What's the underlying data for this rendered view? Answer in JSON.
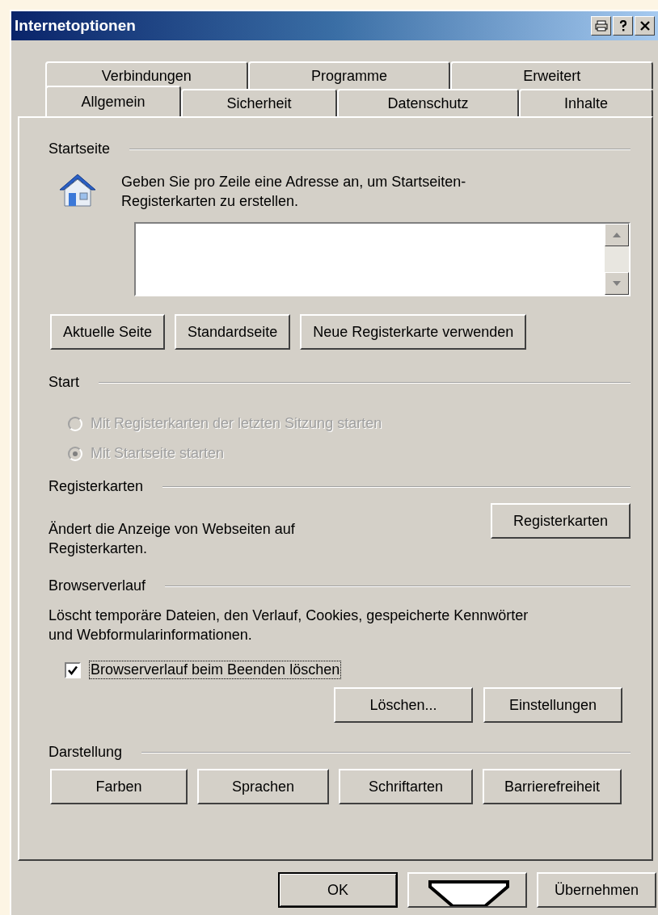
{
  "window": {
    "title": "Internetoptionen"
  },
  "tab_rows": [
    [
      {
        "label": "Verbindungen",
        "selected": false
      },
      {
        "label": "Programme",
        "selected": false
      },
      {
        "label": "Erweitert",
        "selected": false
      }
    ],
    [
      {
        "label": "Allgemein",
        "selected": true
      },
      {
        "label": "Sicherheit",
        "selected": false
      },
      {
        "label": "Datenschutz",
        "selected": false
      },
      {
        "label": "Inhalte",
        "selected": false
      }
    ]
  ],
  "startseite": {
    "heading": "Startseite",
    "description": "Geben Sie pro Zeile eine Adresse an, um Startseiten-Registerkarten zu erstellen.",
    "buttons": [
      "Aktuelle Seite",
      "Standardseite",
      "Neue Registerkarte verwenden"
    ]
  },
  "start": {
    "heading": "Start",
    "options": [
      {
        "label": "Mit Registerkarten der letzten Sitzung starten",
        "selected": false,
        "disabled": true
      },
      {
        "label": "Mit Startseite starten",
        "selected": true,
        "disabled": true
      }
    ]
  },
  "registerkarten": {
    "heading": "Registerkarten",
    "description": "Ändert die Anzeige von Webseiten auf Registerkarten.",
    "button": "Registerkarten"
  },
  "browserverlauf": {
    "heading": "Browserverlauf",
    "description": "Löscht temporäre Dateien, den Verlauf, Cookies, gespeicherte Kennwörter und Webformularinformationen.",
    "checkbox": {
      "label": "Browserverlauf beim Beenden löschen",
      "checked": true
    },
    "buttons": [
      "Löschen...",
      "Einstellungen"
    ]
  },
  "darstellung": {
    "heading": "Darstellung",
    "buttons": [
      "Farben",
      "Sprachen",
      "Schriftarten",
      "Barrierefreiheit"
    ]
  },
  "footer_buttons": [
    {
      "label": "OK",
      "kind": "default"
    },
    {
      "kind": "covered"
    },
    {
      "label": "Übernehmen",
      "kind": "normal"
    }
  ]
}
